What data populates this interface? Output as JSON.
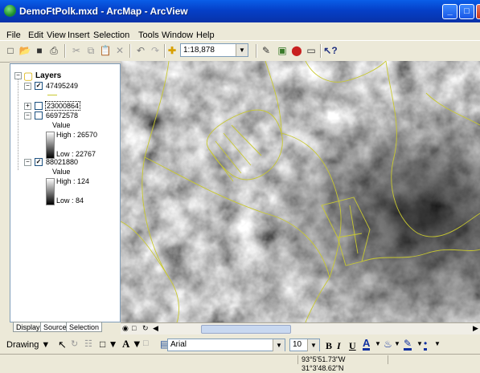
{
  "window": {
    "title": "DemoFtPolk.mxd - ArcMap - ArcView",
    "minimize": "_",
    "maximize": "□",
    "close": "X"
  },
  "menu": [
    "File",
    "Edit",
    "View",
    "Insert",
    "Selection",
    "Tools",
    "Window",
    "Help"
  ],
  "toolbar": {
    "scale": "1:18,878",
    "icons": [
      "new-icon",
      "open-icon",
      "save-icon",
      "print-icon",
      "cut-icon",
      "copy-icon",
      "paste-icon",
      "delete-icon",
      "undo-icon",
      "redo-icon",
      "add-data-icon",
      "editor-icon",
      "arctoolbox-icon",
      "model-icon",
      "command-line-icon",
      "whats-this-icon"
    ]
  },
  "toc": {
    "root": "Layers",
    "layers": [
      {
        "name": "47495249",
        "checked": true,
        "expanded": true
      },
      {
        "name": "23000864",
        "checked": false,
        "expanded": false,
        "selected": true
      },
      {
        "name": "66972578",
        "checked": false,
        "expanded": true,
        "value_label": "Value",
        "high": "High : 26570",
        "low": "Low : 22767"
      },
      {
        "name": "88021880",
        "checked": true,
        "expanded": true,
        "value_label": "Value",
        "high": "High : 124",
        "low": "Low : 84"
      }
    ],
    "tabs": [
      "Display",
      "Source",
      "Selection"
    ]
  },
  "drawing": {
    "label": "Drawing",
    "font": "Arial",
    "size": "10",
    "bold": "B",
    "italic": "I",
    "underline": "U",
    "text_tool": "A"
  },
  "status": {
    "coords": "93°5'51.73\"W  31°3'48.62\"N"
  },
  "colors": {
    "titlebar": "#0540c8",
    "boundary": "#c8c830",
    "panel": "#ece9d8"
  }
}
